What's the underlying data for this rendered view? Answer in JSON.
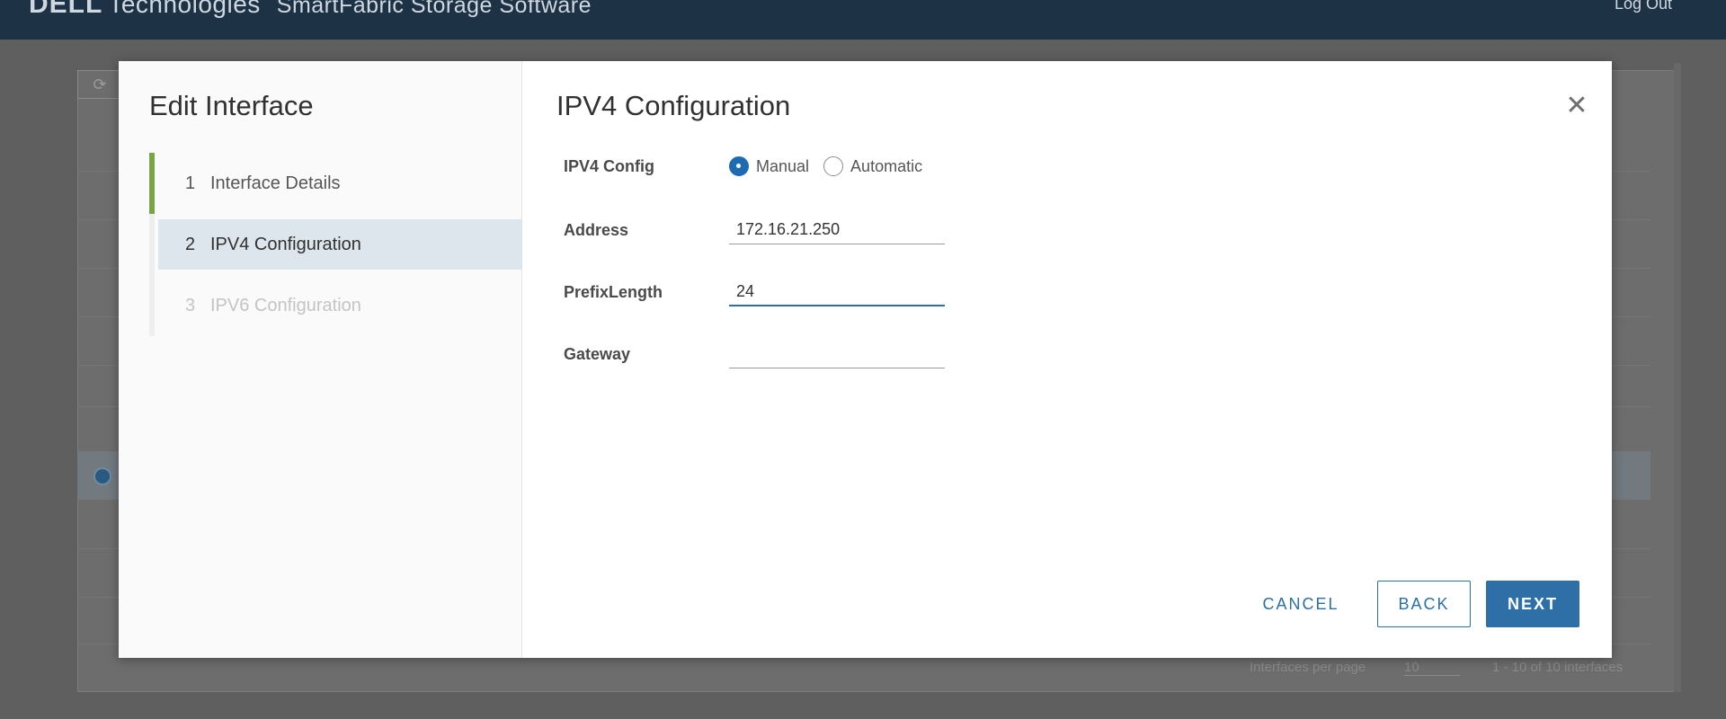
{
  "app": {
    "brand_dell": "DELL",
    "brand_tech": "Technologies",
    "product": "SmartFabric Storage Software",
    "logout": "Log Out"
  },
  "background": {
    "footer_label": "Interfaces per page",
    "page_size": "10",
    "count": "1 - 10 of 10 interfaces"
  },
  "modal": {
    "title": "Edit Interface",
    "steps": [
      {
        "num": "1",
        "label": "Interface Details",
        "state": "done"
      },
      {
        "num": "2",
        "label": "IPV4 Configuration",
        "state": "active"
      },
      {
        "num": "3",
        "label": "IPV6 Configuration",
        "state": "disabled"
      }
    ],
    "content_title": "IPV4 Configuration",
    "close_icon": "close-icon"
  },
  "form": {
    "ipv4_config_label": "IPV4 Config",
    "option_manual": "Manual",
    "option_automatic": "Automatic",
    "selected": "Manual",
    "address_label": "Address",
    "address_value": "172.16.21.250",
    "prefix_label": "PrefixLength",
    "prefix_value": "24",
    "gateway_label": "Gateway",
    "gateway_value": ""
  },
  "buttons": {
    "cancel": "CANCEL",
    "back": "BACK",
    "next": "NEXT"
  },
  "colors": {
    "accent": "#2f6fa7",
    "step_done": "#7aa547",
    "active_step_bg": "#dde6ec"
  }
}
